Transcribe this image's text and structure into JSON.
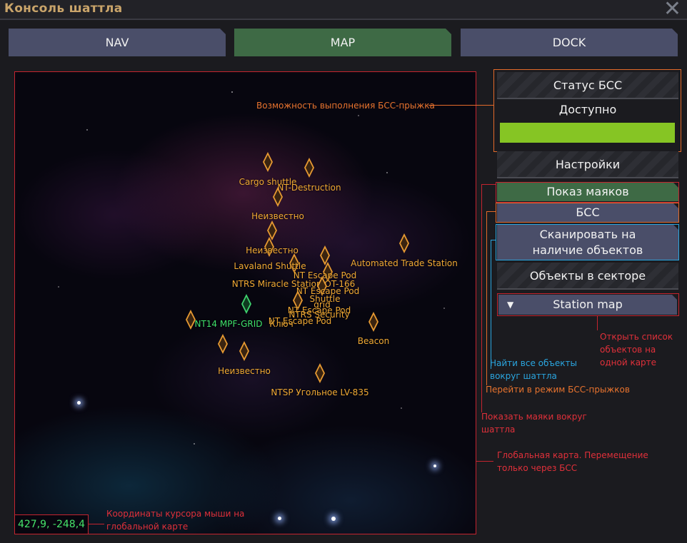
{
  "window": {
    "title": "Консоль шаттла",
    "close_icon": "close-icon"
  },
  "tabs": [
    {
      "label": "NAV",
      "active": false
    },
    {
      "label": "MAP",
      "active": true
    },
    {
      "label": "DOCK",
      "active": false
    }
  ],
  "map": {
    "cursor_coords": "427,9, -248,4",
    "markers": [
      {
        "label": "Cargo shuttle",
        "color": "#e79a32"
      },
      {
        "label": "NT-Destruction",
        "color": "#e79a32"
      },
      {
        "label": "Неизвестно",
        "color": "#e79a32"
      },
      {
        "label": "Неизвестно",
        "color": "#e79a32"
      },
      {
        "label": "Lavaland Shuttle",
        "color": "#e79a32"
      },
      {
        "label": "Automated Trade Station",
        "color": "#e79a32"
      },
      {
        "label": "NT Escape Pod",
        "color": "#e79a32"
      },
      {
        "label": "NTRS Miracle Station OT-166",
        "color": "#e79a32"
      },
      {
        "label": "NT Escape Pod",
        "color": "#e79a32"
      },
      {
        "label": "Shuttle",
        "color": "#e79a32"
      },
      {
        "label": "grid",
        "color": "#e79a32"
      },
      {
        "label": "NT Escape Pod",
        "color": "#e79a32"
      },
      {
        "label": "NTRS Security",
        "color": "#e79a32"
      },
      {
        "label": "NT Escape Pod",
        "color": "#e79a32"
      },
      {
        "label": "Ключ",
        "color": "#e79a32"
      },
      {
        "label": "NT14 MPF-GRID",
        "color": "#3fd26e"
      },
      {
        "label": "Beacon",
        "color": "#e79a32"
      },
      {
        "label": "Неизвестно",
        "color": "#e79a32"
      },
      {
        "label": "NTSP Угольное LV-835",
        "color": "#e79a32"
      }
    ]
  },
  "side": {
    "bss_status_header": "Статус БСС",
    "bss_available": "Доступно",
    "bss_bar_color": "#86c524",
    "settings_header": "Настройки",
    "beacons_button": "Показ маяков",
    "bss_button": "БСС",
    "scan_button_line1": "Сканировать на",
    "scan_button_line2": "наличие объектов",
    "objects_header": "Объекты в секторе",
    "station_map_button": "Station map"
  },
  "annotations": {
    "bss_jump": "Возможность выполнения БСС-прыжка",
    "station_map_1": "Открыть список",
    "station_map_2": "объектов на",
    "station_map_3": "одной карте",
    "scan_1": "Найти все объекты",
    "scan_2": "вокруг шаттла",
    "bss_mode": "Перейти в режим БСС-прыжков",
    "beacons_1": "Показать маяки вокруг",
    "beacons_2": "шаттла",
    "map_1": "Глобальная карта. Перемещение",
    "map_2": "только через БСС",
    "coords_1": "Координаты курсора мыши на",
    "coords_2": "глобальной карте"
  },
  "colors": {
    "accent_red": "#c4242f",
    "accent_orange": "#e36a2a",
    "accent_blue": "#2aa6e0",
    "marker_orange": "#e79a32",
    "marker_green": "#3fd26e"
  }
}
